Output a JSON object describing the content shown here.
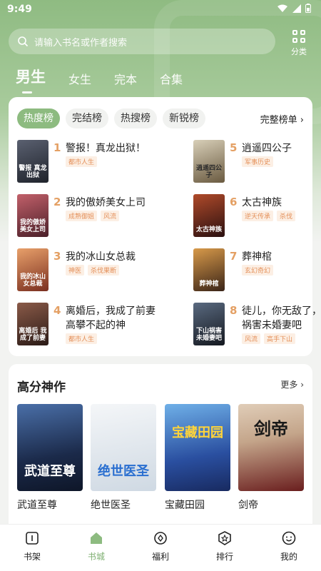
{
  "status": {
    "time": "9:49"
  },
  "search": {
    "placeholder": "请输入书名或作者搜索"
  },
  "category_label": "分类",
  "top_tabs": [
    "男生",
    "女生",
    "完本",
    "合集"
  ],
  "rank": {
    "chips": [
      "热度榜",
      "完结榜",
      "热搜榜",
      "新锐榜"
    ],
    "full_label": "完整榜单",
    "items": [
      {
        "num": "1",
        "title": "警报！真龙出狱！",
        "tags": [
          "都市人生"
        ],
        "cover_text": "警报 真龙出狱",
        "cover_color": "#3b3f4a"
      },
      {
        "num": "2",
        "title": "我的傲娇美女上司",
        "tags": [
          "成熟御姐",
          "风流"
        ],
        "cover_text": "我的傲娇 美女上司",
        "cover_color": "#7a3a3e"
      },
      {
        "num": "3",
        "title": "我的冰山女总裁",
        "tags": [
          "神医",
          "杀伐果断"
        ],
        "cover_text": "我的冰山 女总裁",
        "cover_color": "#b5623a"
      },
      {
        "num": "4",
        "title": "离婚后，我成了前妻高攀不起的神",
        "tags": [
          "都市人生"
        ],
        "cover_text": "离婚后 我成了前妻",
        "cover_color": "#5a3b32"
      },
      {
        "num": "5",
        "title": "逍遥四公子",
        "tags": [
          "军事历史"
        ],
        "cover_text": "逍遥四公子",
        "cover_color": "#8a7a5e"
      },
      {
        "num": "6",
        "title": "太古神族",
        "tags": [
          "逆天传承",
          "杀伐"
        ],
        "cover_text": "太古神族",
        "cover_color": "#4a2a2a"
      },
      {
        "num": "7",
        "title": "葬神棺",
        "tags": [
          "玄幻奇幻"
        ],
        "cover_text": "葬神棺",
        "cover_color": "#6a4b32"
      },
      {
        "num": "8",
        "title": "徒儿，你无敌了，去祸害未婚妻吧",
        "tags": [
          "风流",
          "高手下山"
        ],
        "cover_text": "下山祸害 未婚妻吧",
        "cover_color": "#2e3440"
      }
    ]
  },
  "featured": {
    "title": "高分神作",
    "more_label": "更多",
    "books": [
      {
        "name": "武道至尊",
        "cover_text": "武道至尊",
        "color_a": "#1b2a4a",
        "color_b": "#4a6fa8"
      },
      {
        "name": "绝世医圣",
        "cover_text": "绝世医圣",
        "color_a": "#e9eef3",
        "color_b": "#cfd9e3"
      },
      {
        "name": "宝藏田园",
        "cover_text": "宝藏田园",
        "color_a": "#2a4fa0",
        "color_b": "#6fb0e8"
      },
      {
        "name": "剑帝",
        "cover_text": "剑帝",
        "color_a": "#6a1e1e",
        "color_b": "#c4a58a"
      }
    ]
  },
  "tabbar": [
    {
      "label": "书架",
      "icon": "bookshelf-icon"
    },
    {
      "label": "书城",
      "icon": "bookstore-icon"
    },
    {
      "label": "福利",
      "icon": "welfare-icon"
    },
    {
      "label": "排行",
      "icon": "ranking-icon"
    },
    {
      "label": "我的",
      "icon": "profile-icon"
    }
  ],
  "colors": {
    "accent": "#8dbb80",
    "tag_text": "#e4905a",
    "rank_number": "#e4a064"
  }
}
